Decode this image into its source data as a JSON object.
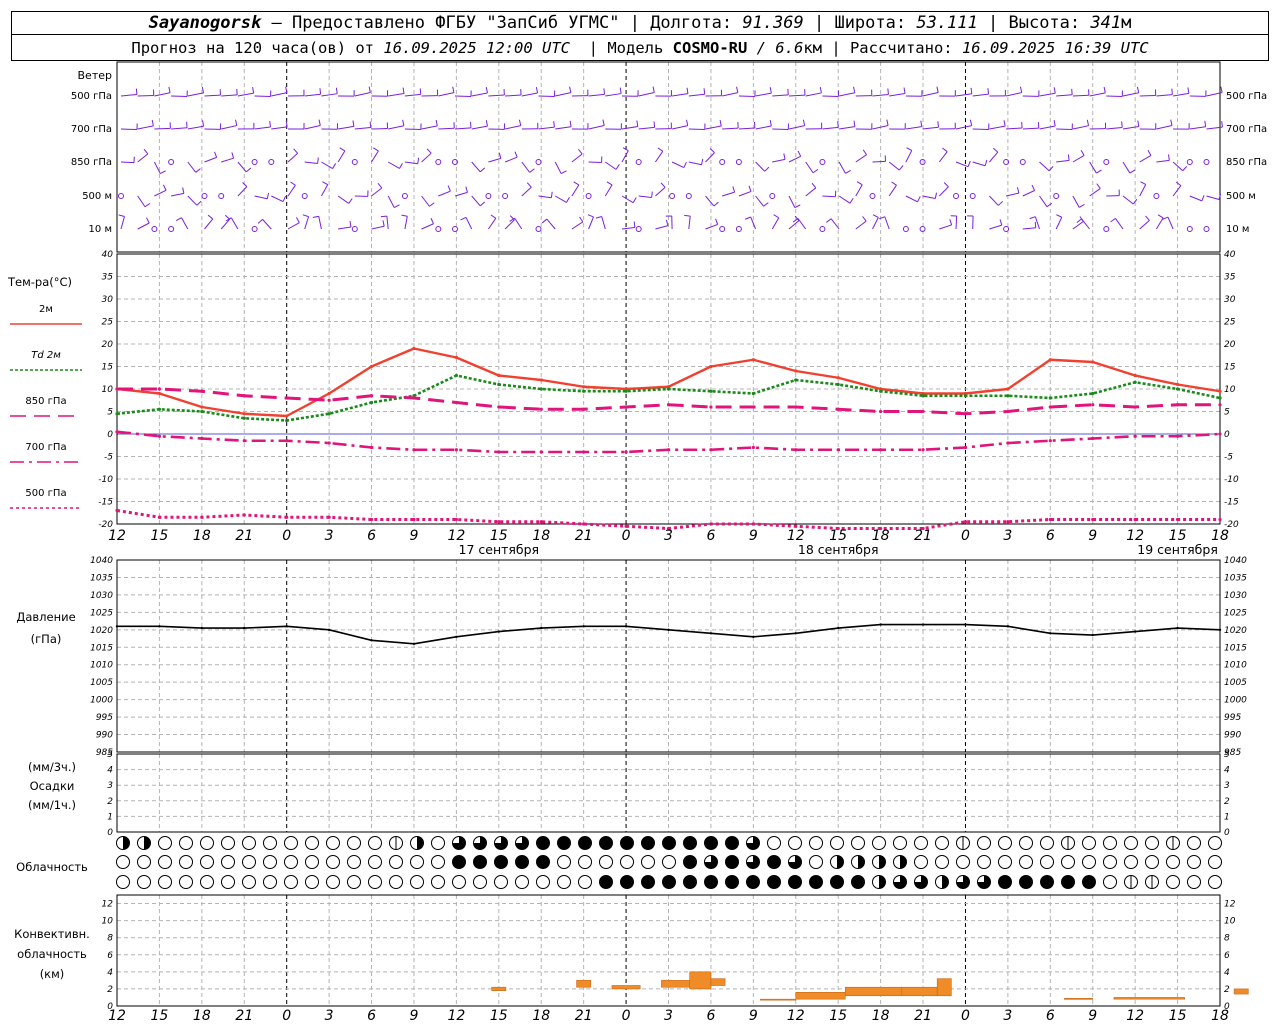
{
  "header": {
    "station": "Sayanogorsk",
    "dash": " — ",
    "provider": "Предоставлено ФГБУ \"ЗапСиб УГМС\"",
    "sep": " | ",
    "lon_label": "Долгота: ",
    "lon_value": "91.369",
    "lat_label": "Широта: ",
    "lat_value": "53.111",
    "alt_label": "Высота: ",
    "alt_value": "341",
    "alt_unit": "м",
    "forecast_prefix": "Прогноз на 120 часа(ов) от ",
    "forecast_from": "16.09.2025 12:00 UTC",
    "model_label": "  | Модель ",
    "model_name": "COSMO-RU",
    "model_res": " / 6.6",
    "model_unit": "км",
    "calc_label": " | Рассчитано: ",
    "calc_value": "16.09.2025 16:39 UTC"
  },
  "labels": {
    "wind_title": "Ветер",
    "wind_levels": [
      "500 гПа",
      "700 гПа",
      "850 гПа",
      "500 м",
      "10  м"
    ],
    "temp_title": "Тем-ра(°C)",
    "legend": [
      {
        "label": "2м",
        "color": "#f04030"
      },
      {
        "label": "Td  2м",
        "color": "#1a8a1a"
      },
      {
        "label": "850 гПа",
        "color": "#e0147a"
      },
      {
        "label": "700 гПа",
        "color": "#e0147a"
      },
      {
        "label": "500 гПа",
        "color": "#e0147a"
      }
    ],
    "pressure_title": "Давление",
    "pressure_unit": "(гПа)",
    "precip_unit_top": "(мм/3ч.)",
    "precip_title": "Осадки",
    "precip_unit_bottom": "(мм/1ч.)",
    "cloud_title": "Облачность",
    "conv_title1": "Конвективн.",
    "conv_title2": "облачность",
    "conv_unit": "(км)",
    "day_labels": [
      "17 сентября",
      "18 сентября",
      "19 сентября"
    ],
    "hour_ticks": [
      "12",
      "15",
      "18",
      "21",
      "0",
      "3",
      "6",
      "9",
      "12",
      "15",
      "18",
      "21",
      "0",
      "3",
      "6",
      "9",
      "12",
      "15",
      "18",
      "21",
      "0",
      "3",
      "6",
      "9",
      "12",
      "15",
      "18"
    ]
  },
  "colors": {
    "wind": "#7a1ee0",
    "t2m": "#f04030",
    "td2m": "#1a8a1a",
    "upper": "#e0147a",
    "pressure": "#000000",
    "conv": "#f08c28",
    "grid": "#b4b4b4"
  },
  "chart_data": [
    {
      "type": "line",
      "title": "Тем-ра(°C)",
      "x_hours": [
        0,
        3,
        6,
        9,
        12,
        15,
        18,
        21,
        24,
        27,
        30,
        33,
        36,
        39,
        42,
        45,
        48,
        51,
        54,
        57,
        60,
        63,
        66,
        69,
        72,
        75,
        78
      ],
      "ylim": [
        -20,
        40
      ],
      "yticks": [
        40,
        35,
        30,
        25,
        20,
        15,
        10,
        5,
        0,
        -5,
        -10,
        -15,
        -20
      ],
      "series": [
        {
          "name": "2м",
          "values": [
            10,
            9,
            6,
            4.5,
            4,
            9,
            15,
            19,
            17,
            13,
            12,
            10.5,
            10,
            10.5,
            15,
            16.5,
            14,
            12.5,
            10,
            9,
            9,
            10,
            16.5,
            16,
            13,
            11,
            9.5
          ]
        },
        {
          "name": "Td  2м",
          "values": [
            4.5,
            5.5,
            5,
            3.5,
            3,
            4.5,
            7,
            8.5,
            13,
            11,
            10,
            9.5,
            9.5,
            10,
            9.5,
            9,
            12,
            11,
            9.5,
            8.5,
            8.5,
            8.5,
            8,
            9,
            11.5,
            10,
            8
          ]
        },
        {
          "name": "850 гПа",
          "values": [
            10,
            10,
            9.5,
            8.5,
            8,
            7.5,
            8.5,
            8,
            7,
            6,
            5.5,
            5.5,
            6,
            6.5,
            6,
            6,
            6,
            5.5,
            5,
            5,
            4.5,
            5,
            6,
            6.5,
            6,
            6.5,
            6.5
          ]
        },
        {
          "name": "700 гПа",
          "values": [
            0.5,
            -0.5,
            -1,
            -1.5,
            -1.5,
            -2,
            -3,
            -3.5,
            -3.5,
            -4,
            -4,
            -4,
            -4,
            -3.5,
            -3.5,
            -3,
            -3.5,
            -3.5,
            -3.5,
            -3.5,
            -3,
            -2,
            -1.5,
            -1,
            -0.5,
            -0.5,
            0
          ]
        },
        {
          "name": "500 гПа",
          "values": [
            -17,
            -18.5,
            -18.5,
            -18,
            -18.5,
            -18.5,
            -19,
            -19,
            -19,
            -19.5,
            -19.5,
            -20,
            -20.5,
            -21,
            -20,
            -20,
            -20.5,
            -21,
            -21,
            -21,
            -19.5,
            -19.5,
            -19,
            -19,
            -19,
            -19,
            -19
          ]
        }
      ]
    },
    {
      "type": "line",
      "title": "Давление",
      "x_hours": [
        0,
        3,
        6,
        9,
        12,
        15,
        18,
        21,
        24,
        27,
        30,
        33,
        36,
        39,
        42,
        45,
        48,
        51,
        54,
        57,
        60,
        63,
        66,
        69,
        72,
        75,
        78
      ],
      "ylim": [
        985,
        1040
      ],
      "yticks": [
        1040,
        1035,
        1030,
        1025,
        1020,
        1015,
        1010,
        1005,
        1000,
        995,
        990,
        985
      ],
      "series": [
        {
          "name": "Давление",
          "values": [
            1021,
            1021,
            1020.5,
            1020.5,
            1021,
            1020,
            1017,
            1016,
            1018,
            1019.5,
            1020.5,
            1021,
            1021,
            1020,
            1019,
            1018,
            1019,
            1020.5,
            1021.5,
            1021.5,
            1021.5,
            1021,
            1019,
            1018.5,
            1019.5,
            1020.5,
            1020
          ]
        }
      ]
    },
    {
      "type": "bar",
      "title": "Осадки",
      "ylim": [
        0,
        5
      ],
      "yticks": [
        5,
        4,
        3,
        2,
        1,
        0
      ],
      "values": []
    },
    {
      "type": "bar",
      "title": "Конвективн. облачность",
      "ylim": [
        0,
        13
      ],
      "yticks": [
        12,
        10,
        8,
        6,
        4,
        2,
        0
      ],
      "bars": [
        {
          "x0": 26.5,
          "x1": 27.5,
          "bottom": 1.8,
          "top": 2.2
        },
        {
          "x0": 32.5,
          "x1": 33.5,
          "bottom": 2.2,
          "top": 3.0
        },
        {
          "x0": 35.0,
          "x1": 37.0,
          "bottom": 2.0,
          "top": 2.4
        },
        {
          "x0": 38.5,
          "x1": 41.5,
          "bottom": 2.2,
          "top": 3.0
        },
        {
          "x0": 40.5,
          "x1": 42.0,
          "bottom": 2.0,
          "top": 4.0
        },
        {
          "x0": 42.0,
          "x1": 43.0,
          "bottom": 2.4,
          "top": 3.2
        },
        {
          "x0": 45.5,
          "x1": 48.0,
          "bottom": 0.7,
          "top": 0.8
        },
        {
          "x0": 48.0,
          "x1": 51.5,
          "bottom": 0.8,
          "top": 1.6
        },
        {
          "x0": 51.5,
          "x1": 55.5,
          "bottom": 1.2,
          "top": 2.2
        },
        {
          "x0": 55.5,
          "x1": 58.0,
          "bottom": 1.2,
          "top": 2.2
        },
        {
          "x0": 58.0,
          "x1": 59.0,
          "bottom": 1.2,
          "top": 3.2
        },
        {
          "x0": 67.0,
          "x1": 69.0,
          "bottom": 0.8,
          "top": 0.9
        },
        {
          "x0": 70.5,
          "x1": 75.5,
          "bottom": 0.8,
          "top": 1.0
        },
        {
          "x0": 79.0,
          "x1": 80.0,
          "bottom": 1.4,
          "top": 2.0
        }
      ]
    }
  ]
}
